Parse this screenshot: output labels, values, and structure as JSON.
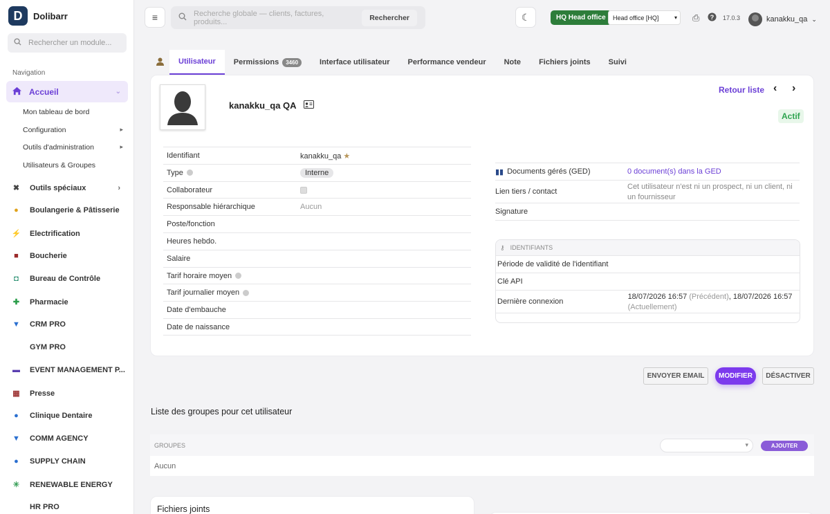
{
  "app": {
    "logo_letter": "D",
    "name": "Dolibarr"
  },
  "sidebar": {
    "search_placeholder": "Rechercher un module...",
    "nav_title": "Navigation",
    "active": {
      "label": "Accueil"
    },
    "sub_items": [
      {
        "label": "Mon tableau de bord",
        "arrow": ""
      },
      {
        "label": "Configuration",
        "arrow": "▸"
      },
      {
        "label": "Outils d'administration",
        "arrow": "▸"
      },
      {
        "label": "Utilisateurs & Groupes",
        "arrow": ""
      }
    ],
    "modules": [
      {
        "label": "Outils spéciaux",
        "icon": "✖",
        "icon_name": "tools-icon",
        "color": "#444"
      },
      {
        "label": "Boulangerie & Pâtisserie",
        "icon": "●",
        "icon_name": "bread-icon",
        "color": "#e0a21b"
      },
      {
        "label": "Electrification",
        "icon": "⚡",
        "icon_name": "lightning-icon",
        "color": "#f0b400"
      },
      {
        "label": "Boucherie",
        "icon": "■",
        "icon_name": "meat-icon",
        "color": "#9b2a2a"
      },
      {
        "label": "Bureau de Contrôle",
        "icon": "◘",
        "icon_name": "shield-check-icon",
        "color": "#1f8a6a"
      },
      {
        "label": "Pharmacie",
        "icon": "✚",
        "icon_name": "medical-cross-icon",
        "color": "#2a9d4a"
      },
      {
        "label": "CRM PRO",
        "icon": "▼",
        "icon_name": "funnel-icon",
        "color": "#2a6fd0"
      },
      {
        "label": "GYM PRO",
        "icon": "",
        "icon_name": "gym-icon",
        "color": "#444"
      },
      {
        "label": "EVENT MANAGEMENT P...",
        "icon": "▬",
        "icon_name": "calendar-icon",
        "color": "#5a3fb0"
      },
      {
        "label": "Presse",
        "icon": "▦",
        "icon_name": "newspaper-icon",
        "color": "#a03a3a"
      },
      {
        "label": "Clinique Dentaire",
        "icon": "●",
        "icon_name": "tooth-icon",
        "color": "#2a6fd0"
      },
      {
        "label": "COMM AGENCY",
        "icon": "▼",
        "icon_name": "funnel-icon",
        "color": "#2a6fd0"
      },
      {
        "label": "SUPPLY CHAIN",
        "icon": "●",
        "icon_name": "box-icon",
        "color": "#2a6fd0"
      },
      {
        "label": "RENEWABLE ENERGY",
        "icon": "✳",
        "icon_name": "sun-icon",
        "color": "#3aa05a"
      },
      {
        "label": "HR PRO",
        "icon": "",
        "icon_name": "hr-icon",
        "color": "#444"
      }
    ]
  },
  "topbar": {
    "search_placeholder": "Recherche globale — clients, factures, produits...",
    "search_button": "Rechercher",
    "hq_badge": "HQ Head office",
    "entity_select": "Head office [HQ]",
    "version": "17.0.3",
    "username": "kanakku_qa"
  },
  "tabs": [
    {
      "label": "Utilisateur",
      "badge": ""
    },
    {
      "label": "Permissions",
      "badge": "3460"
    },
    {
      "label": "Interface utilisateur",
      "badge": ""
    },
    {
      "label": "Performance vendeur",
      "badge": ""
    },
    {
      "label": "Note",
      "badge": ""
    },
    {
      "label": "Fichiers joints",
      "badge": ""
    },
    {
      "label": "Suivi",
      "badge": ""
    }
  ],
  "user_card": {
    "fullname": "kanakku_qa QA",
    "retour": "Retour liste",
    "status": "Actif",
    "fields": [
      {
        "label": "Identifiant",
        "value": "kanakku_qa ★"
      },
      {
        "label": "Type",
        "value": "Interne"
      },
      {
        "label": "Collaborateur",
        "value": ""
      },
      {
        "label": "Responsable hiérarchique",
        "value": "Aucun"
      },
      {
        "label": "Poste/fonction",
        "value": ""
      },
      {
        "label": "Heures hebdo.",
        "value": ""
      },
      {
        "label": "Salaire",
        "value": ""
      },
      {
        "label": "Tarif horaire moyen",
        "value": ""
      },
      {
        "label": "Tarif journalier moyen",
        "value": ""
      },
      {
        "label": "Date d'embauche",
        "value": ""
      },
      {
        "label": "Date de naissance",
        "value": ""
      }
    ],
    "right": {
      "ged_label": "Documents gérés (GED)",
      "ged_value": "0 document(s) dans la GED",
      "tiers_label": "Lien tiers / contact",
      "tiers_value": "Cet utilisateur n'est ni un prospect, ni un client, ni un fournisseur",
      "signature_label": "Signature"
    },
    "identifiants": {
      "title": "IDENTIFIANTS",
      "validity_label": "Période de validité de l'identifiant",
      "api_label": "Clé API",
      "login_label": "Dernière connexion",
      "login_prev": "18/07/2026 16:57",
      "login_prev_tag": "(Précédent)",
      "login_curr": "18/07/2026 16:57",
      "login_curr_tag": "(Actuellement)"
    }
  },
  "actions": {
    "email": "ENVOYER EMAIL",
    "modify": "MODIFIER",
    "disable": "DÉSACTIVER"
  },
  "groups": {
    "title": "Liste des groupes pour cet utilisateur",
    "header": "GROUPES",
    "add": "AJOUTER",
    "empty": "Aucun"
  },
  "files": {
    "title": "Fichiers joints"
  },
  "colors": {
    "accent": "#6b3fd6",
    "success": "#2ea44f",
    "hq": "#2d7d3a"
  }
}
